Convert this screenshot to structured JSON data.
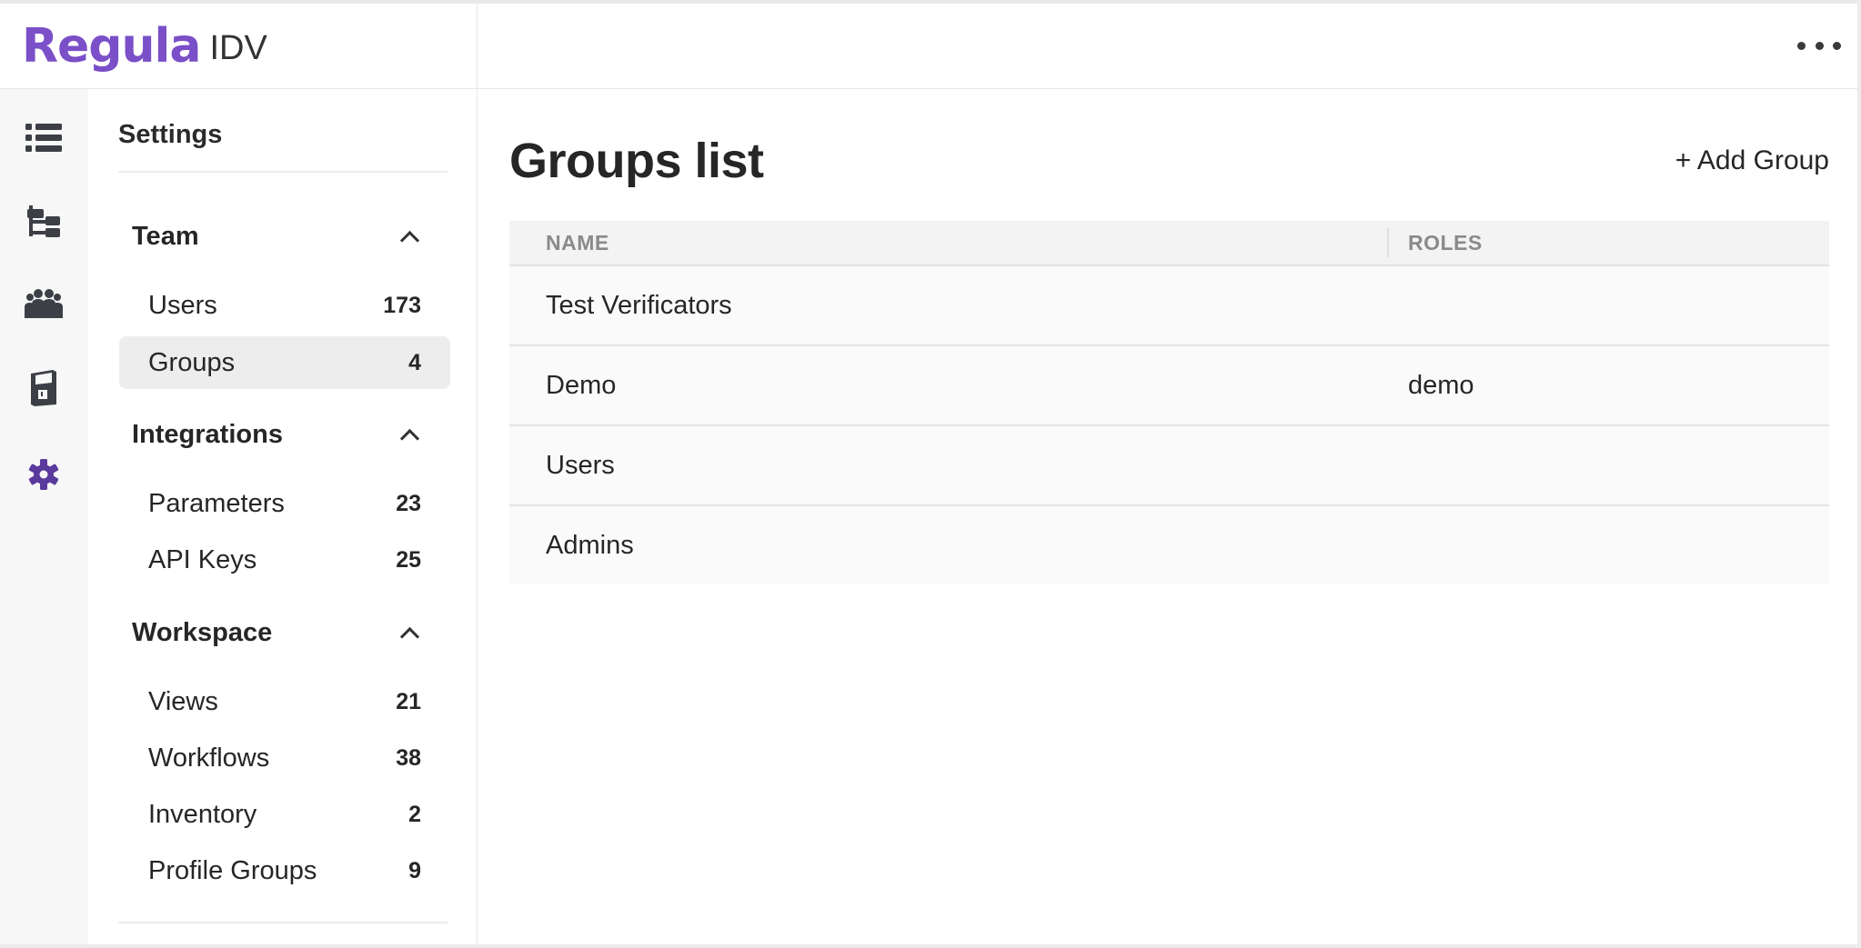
{
  "header": {
    "brand": "Regula",
    "product": "IDV",
    "more_icon": "ellipsis-icon"
  },
  "rail": {
    "items": [
      {
        "icon": "list-icon"
      },
      {
        "icon": "workflow-tree-icon"
      },
      {
        "icon": "team-icon"
      },
      {
        "icon": "kiosk-device-icon"
      },
      {
        "icon": "gear-icon",
        "active": true
      }
    ],
    "active_color": "#5b3a9e"
  },
  "settings": {
    "title": "Settings",
    "sections": [
      {
        "label": "Team",
        "items": [
          {
            "label": "Users",
            "count": "173"
          },
          {
            "label": "Groups",
            "count": "4",
            "active": true
          }
        ]
      },
      {
        "label": "Integrations",
        "items": [
          {
            "label": "Parameters",
            "count": "23"
          },
          {
            "label": "API Keys",
            "count": "25"
          }
        ]
      },
      {
        "label": "Workspace",
        "items": [
          {
            "label": "Views",
            "count": "21"
          },
          {
            "label": "Workflows",
            "count": "38"
          },
          {
            "label": "Inventory",
            "count": "2"
          },
          {
            "label": "Profile Groups",
            "count": "9"
          }
        ]
      }
    ]
  },
  "main": {
    "title": "Groups list",
    "add_label": "+ Add Group",
    "table": {
      "headers": {
        "name": "NAME",
        "roles": "ROLES"
      },
      "rows": [
        {
          "name": "Test Verificators",
          "roles": ""
        },
        {
          "name": "Demo",
          "roles": "demo"
        },
        {
          "name": "Users",
          "roles": ""
        },
        {
          "name": "Admins",
          "roles": ""
        }
      ]
    }
  },
  "colors": {
    "brand": "#7a4fc7",
    "accent": "#5b3a9e"
  }
}
